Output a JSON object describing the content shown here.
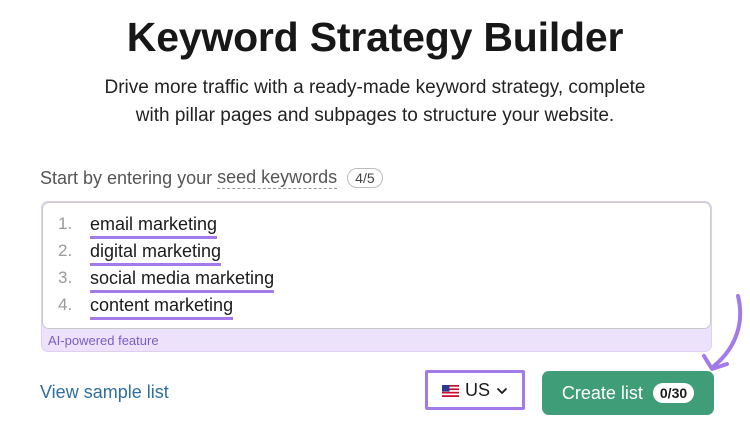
{
  "header": {
    "title": "Keyword Strategy Builder",
    "subtitle_line1": "Drive more traffic with a ready-made keyword strategy, complete",
    "subtitle_line2": "with pillar pages and subpages to structure your website."
  },
  "seed": {
    "prompt": "Start by entering your",
    "link_label": "seed keywords",
    "count": "4/5"
  },
  "keywords": [
    {
      "num": "1.",
      "text": "email marketing"
    },
    {
      "num": "2.",
      "text": "digital marketing"
    },
    {
      "num": "3.",
      "text": "social media marketing"
    },
    {
      "num": "4.",
      "text": "content marketing"
    }
  ],
  "ai_label": "AI-powered feature",
  "footer": {
    "sample_link": "View sample list",
    "country": "US",
    "create_label": "Create list",
    "create_count": "0/30"
  },
  "colors": {
    "accent_purple": "#a27be8",
    "button_green": "#3f9d78",
    "link_blue": "#2e6f9e"
  },
  "icons": [
    "us-flag-icon",
    "chevron-down-icon",
    "curved-arrow-icon"
  ]
}
